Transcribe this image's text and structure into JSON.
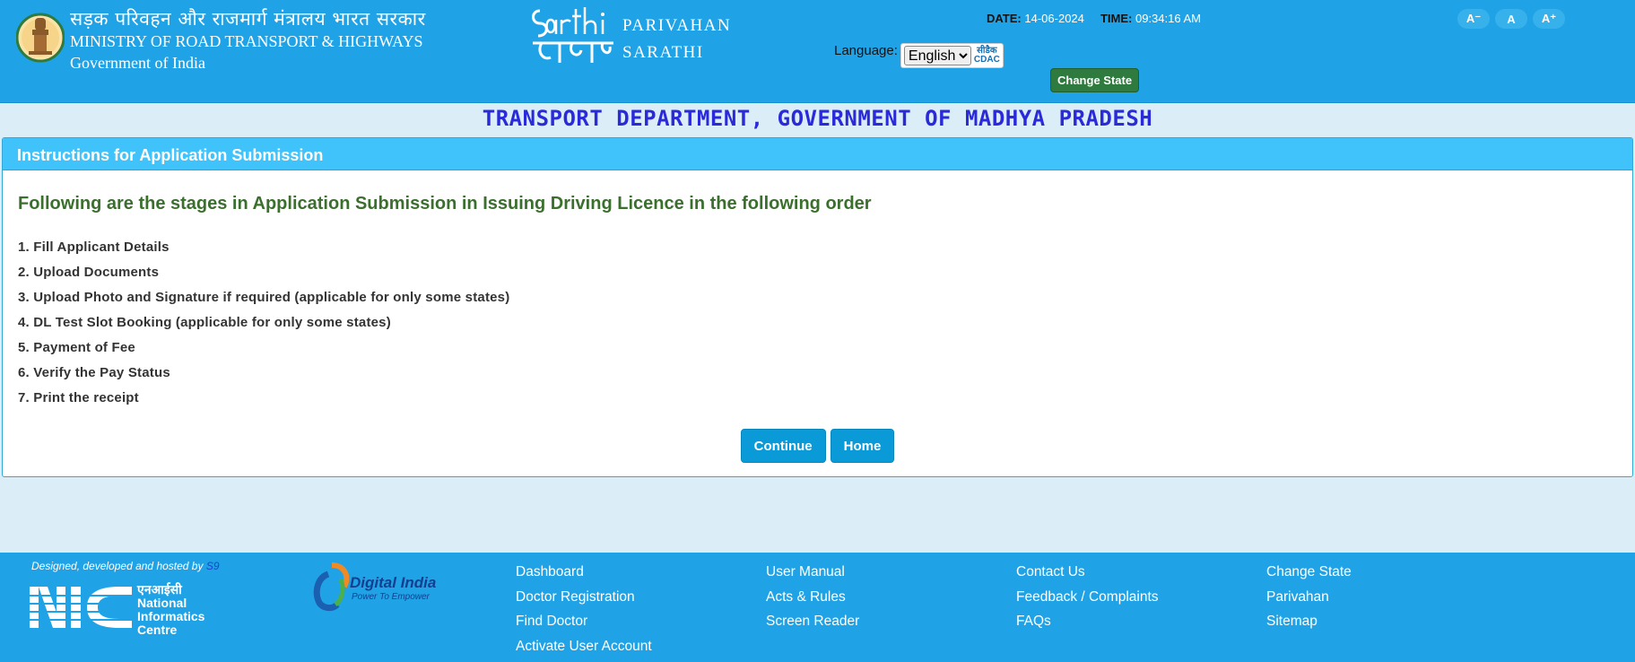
{
  "header": {
    "ministry_hindi": "सड़क परिवहन और राजमार्ग मंत्रालय भारत सरकार",
    "ministry_english": "MINISTRY OF ROAD TRANSPORT & HIGHWAYS",
    "government": "Government of India",
    "sarathi_line1": "PARIVAHAN",
    "sarathi_line2": "SARATHI",
    "date_label": "DATE:",
    "date_value": "14-06-2024",
    "time_label": "TIME:",
    "time_value": "09:34:16 AM",
    "language_label": "Language:",
    "language_selected": "English",
    "cdac_hindi": "सीडैक",
    "cdac_eng": "CDAC",
    "change_state": "Change State",
    "font_small": "A⁻",
    "font_normal": "A",
    "font_large": "A⁺"
  },
  "department_title": "TRANSPORT DEPARTMENT, GOVERNMENT OF MADHYA PRADESH",
  "panel": {
    "title": "Instructions for Application Submission",
    "heading": "Following are the stages in Application Submission in Issuing Driving Licence in the following order",
    "steps": [
      "1. Fill Applicant Details",
      "2. Upload Documents",
      "3. Upload Photo and Signature if required (applicable for only some states)",
      "4. DL Test Slot Booking (applicable for only some states)",
      "5. Payment of Fee",
      "6. Verify the Pay Status",
      "7. Print the receipt"
    ],
    "continue_label": "Continue",
    "home_label": "Home"
  },
  "footer": {
    "designed_by": "Designed, developed and hosted by",
    "designer": "S9",
    "nic_hindi": "एनआईसी",
    "nic_line1": "National",
    "nic_line2": "Informatics",
    "nic_line3": "Centre",
    "digital_india": "Digital India",
    "digital_tagline": "Power To Empower",
    "col1": [
      "Dashboard",
      "Doctor Registration",
      "Find Doctor",
      "Activate User Account"
    ],
    "col2": [
      "User Manual",
      "Acts & Rules",
      "Screen Reader"
    ],
    "col3": [
      "Contact Us",
      "Feedback / Complaints",
      "FAQs"
    ],
    "col4": [
      "Change State",
      "Parivahan",
      "Sitemap"
    ]
  },
  "colors": {
    "header_bg": "#1fa3e6",
    "page_bg": "#dbeef7",
    "panel_header": "#40c3fb",
    "heading_green": "#3b6f2e",
    "title_blue": "#2a2adb",
    "button_blue": "#0b9ad8",
    "change_state_green": "#2f7a3e"
  }
}
